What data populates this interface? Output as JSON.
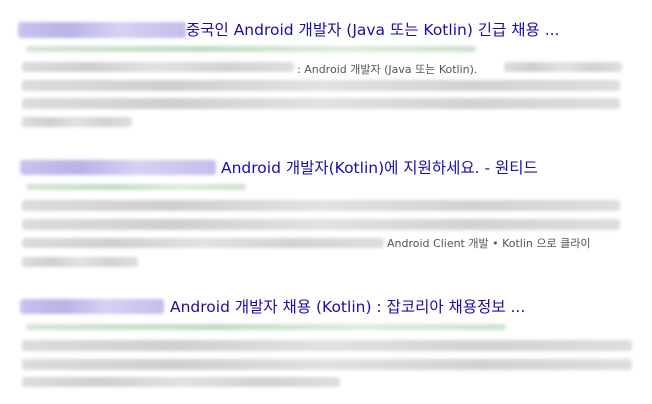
{
  "results": [
    {
      "title_visible": "중국인 Android 개발자 (Java 또는 Kotlin) 긴급 채용 ...",
      "snippet_visible": ": Android 개발자 (Java 또는 Kotlin)."
    },
    {
      "title_visible": "Android 개발자(Kotlin)에 지원하세요. - 원티드",
      "snippet_visible": "Android Client 개발 • Kotlin 으로 클라이"
    },
    {
      "title_visible": "Android 개발자 채용 (Kotlin) : 잡코리아 채용정보 ..."
    }
  ],
  "colors": {
    "title_link": "#1a0dab",
    "snippet_text": "#545454",
    "url_green": "#006621"
  }
}
